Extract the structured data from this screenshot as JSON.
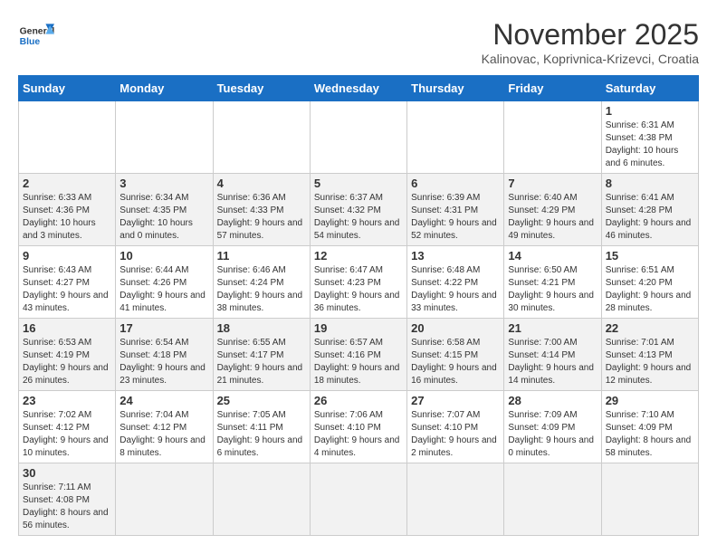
{
  "header": {
    "logo_general": "General",
    "logo_blue": "Blue",
    "month_title": "November 2025",
    "subtitle": "Kalinovac, Koprivnica-Krizevci, Croatia"
  },
  "weekdays": [
    "Sunday",
    "Monday",
    "Tuesday",
    "Wednesday",
    "Thursday",
    "Friday",
    "Saturday"
  ],
  "weeks": [
    [
      null,
      null,
      null,
      null,
      null,
      null,
      {
        "day": 1,
        "sunrise": "6:31 AM",
        "sunset": "4:38 PM",
        "daylight": "10 hours and 6 minutes."
      }
    ],
    [
      {
        "day": 2,
        "sunrise": "6:33 AM",
        "sunset": "4:36 PM",
        "daylight": "10 hours and 3 minutes."
      },
      {
        "day": 3,
        "sunrise": "6:34 AM",
        "sunset": "4:35 PM",
        "daylight": "10 hours and 0 minutes."
      },
      {
        "day": 4,
        "sunrise": "6:36 AM",
        "sunset": "4:33 PM",
        "daylight": "9 hours and 57 minutes."
      },
      {
        "day": 5,
        "sunrise": "6:37 AM",
        "sunset": "4:32 PM",
        "daylight": "9 hours and 54 minutes."
      },
      {
        "day": 6,
        "sunrise": "6:39 AM",
        "sunset": "4:31 PM",
        "daylight": "9 hours and 52 minutes."
      },
      {
        "day": 7,
        "sunrise": "6:40 AM",
        "sunset": "4:29 PM",
        "daylight": "9 hours and 49 minutes."
      },
      {
        "day": 8,
        "sunrise": "6:41 AM",
        "sunset": "4:28 PM",
        "daylight": "9 hours and 46 minutes."
      }
    ],
    [
      {
        "day": 9,
        "sunrise": "6:43 AM",
        "sunset": "4:27 PM",
        "daylight": "9 hours and 43 minutes."
      },
      {
        "day": 10,
        "sunrise": "6:44 AM",
        "sunset": "4:26 PM",
        "daylight": "9 hours and 41 minutes."
      },
      {
        "day": 11,
        "sunrise": "6:46 AM",
        "sunset": "4:24 PM",
        "daylight": "9 hours and 38 minutes."
      },
      {
        "day": 12,
        "sunrise": "6:47 AM",
        "sunset": "4:23 PM",
        "daylight": "9 hours and 36 minutes."
      },
      {
        "day": 13,
        "sunrise": "6:48 AM",
        "sunset": "4:22 PM",
        "daylight": "9 hours and 33 minutes."
      },
      {
        "day": 14,
        "sunrise": "6:50 AM",
        "sunset": "4:21 PM",
        "daylight": "9 hours and 30 minutes."
      },
      {
        "day": 15,
        "sunrise": "6:51 AM",
        "sunset": "4:20 PM",
        "daylight": "9 hours and 28 minutes."
      }
    ],
    [
      {
        "day": 16,
        "sunrise": "6:53 AM",
        "sunset": "4:19 PM",
        "daylight": "9 hours and 26 minutes."
      },
      {
        "day": 17,
        "sunrise": "6:54 AM",
        "sunset": "4:18 PM",
        "daylight": "9 hours and 23 minutes."
      },
      {
        "day": 18,
        "sunrise": "6:55 AM",
        "sunset": "4:17 PM",
        "daylight": "9 hours and 21 minutes."
      },
      {
        "day": 19,
        "sunrise": "6:57 AM",
        "sunset": "4:16 PM",
        "daylight": "9 hours and 18 minutes."
      },
      {
        "day": 20,
        "sunrise": "6:58 AM",
        "sunset": "4:15 PM",
        "daylight": "9 hours and 16 minutes."
      },
      {
        "day": 21,
        "sunrise": "7:00 AM",
        "sunset": "4:14 PM",
        "daylight": "9 hours and 14 minutes."
      },
      {
        "day": 22,
        "sunrise": "7:01 AM",
        "sunset": "4:13 PM",
        "daylight": "9 hours and 12 minutes."
      }
    ],
    [
      {
        "day": 23,
        "sunrise": "7:02 AM",
        "sunset": "4:12 PM",
        "daylight": "9 hours and 10 minutes."
      },
      {
        "day": 24,
        "sunrise": "7:04 AM",
        "sunset": "4:12 PM",
        "daylight": "9 hours and 8 minutes."
      },
      {
        "day": 25,
        "sunrise": "7:05 AM",
        "sunset": "4:11 PM",
        "daylight": "9 hours and 6 minutes."
      },
      {
        "day": 26,
        "sunrise": "7:06 AM",
        "sunset": "4:10 PM",
        "daylight": "9 hours and 4 minutes."
      },
      {
        "day": 27,
        "sunrise": "7:07 AM",
        "sunset": "4:10 PM",
        "daylight": "9 hours and 2 minutes."
      },
      {
        "day": 28,
        "sunrise": "7:09 AM",
        "sunset": "4:09 PM",
        "daylight": "9 hours and 0 minutes."
      },
      {
        "day": 29,
        "sunrise": "7:10 AM",
        "sunset": "4:09 PM",
        "daylight": "8 hours and 58 minutes."
      }
    ],
    [
      {
        "day": 30,
        "sunrise": "7:11 AM",
        "sunset": "4:08 PM",
        "daylight": "8 hours and 56 minutes."
      },
      null,
      null,
      null,
      null,
      null,
      null
    ]
  ]
}
